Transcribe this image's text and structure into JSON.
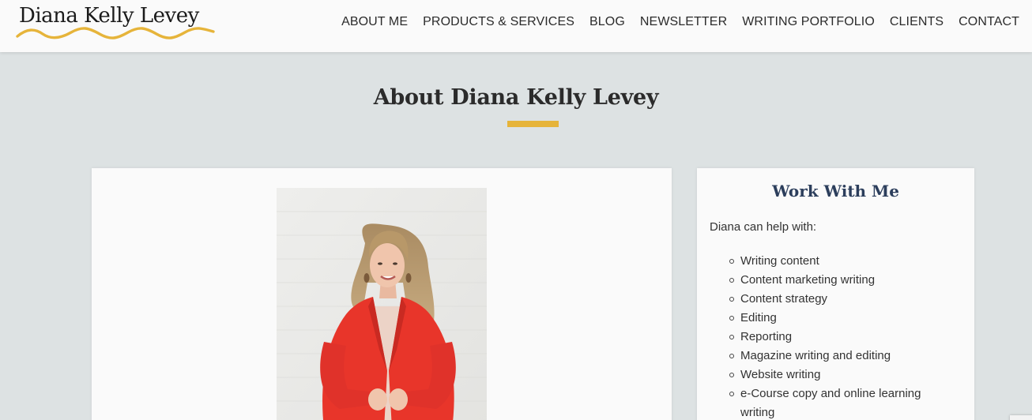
{
  "brand": {
    "name": "Diana Kelly Levey",
    "accent_color": "#e6b43a"
  },
  "nav": {
    "items": [
      {
        "label": "ABOUT ME"
      },
      {
        "label": "PRODUCTS & SERVICES"
      },
      {
        "label": "BLOG"
      },
      {
        "label": "NEWSLETTER"
      },
      {
        "label": "WRITING PORTFOLIO"
      },
      {
        "label": "CLIENTS"
      },
      {
        "label": "CONTACT"
      }
    ]
  },
  "page": {
    "title": "About Diana Kelly Levey"
  },
  "sidebar": {
    "title": "Work With Me",
    "intro": "Diana can help with:",
    "items": [
      "Writing content",
      "Content marketing writing",
      "Content strategy",
      "Editing",
      "Reporting",
      "Magazine writing and editing",
      "Website writing",
      "e-Course copy and online learning writing"
    ]
  }
}
